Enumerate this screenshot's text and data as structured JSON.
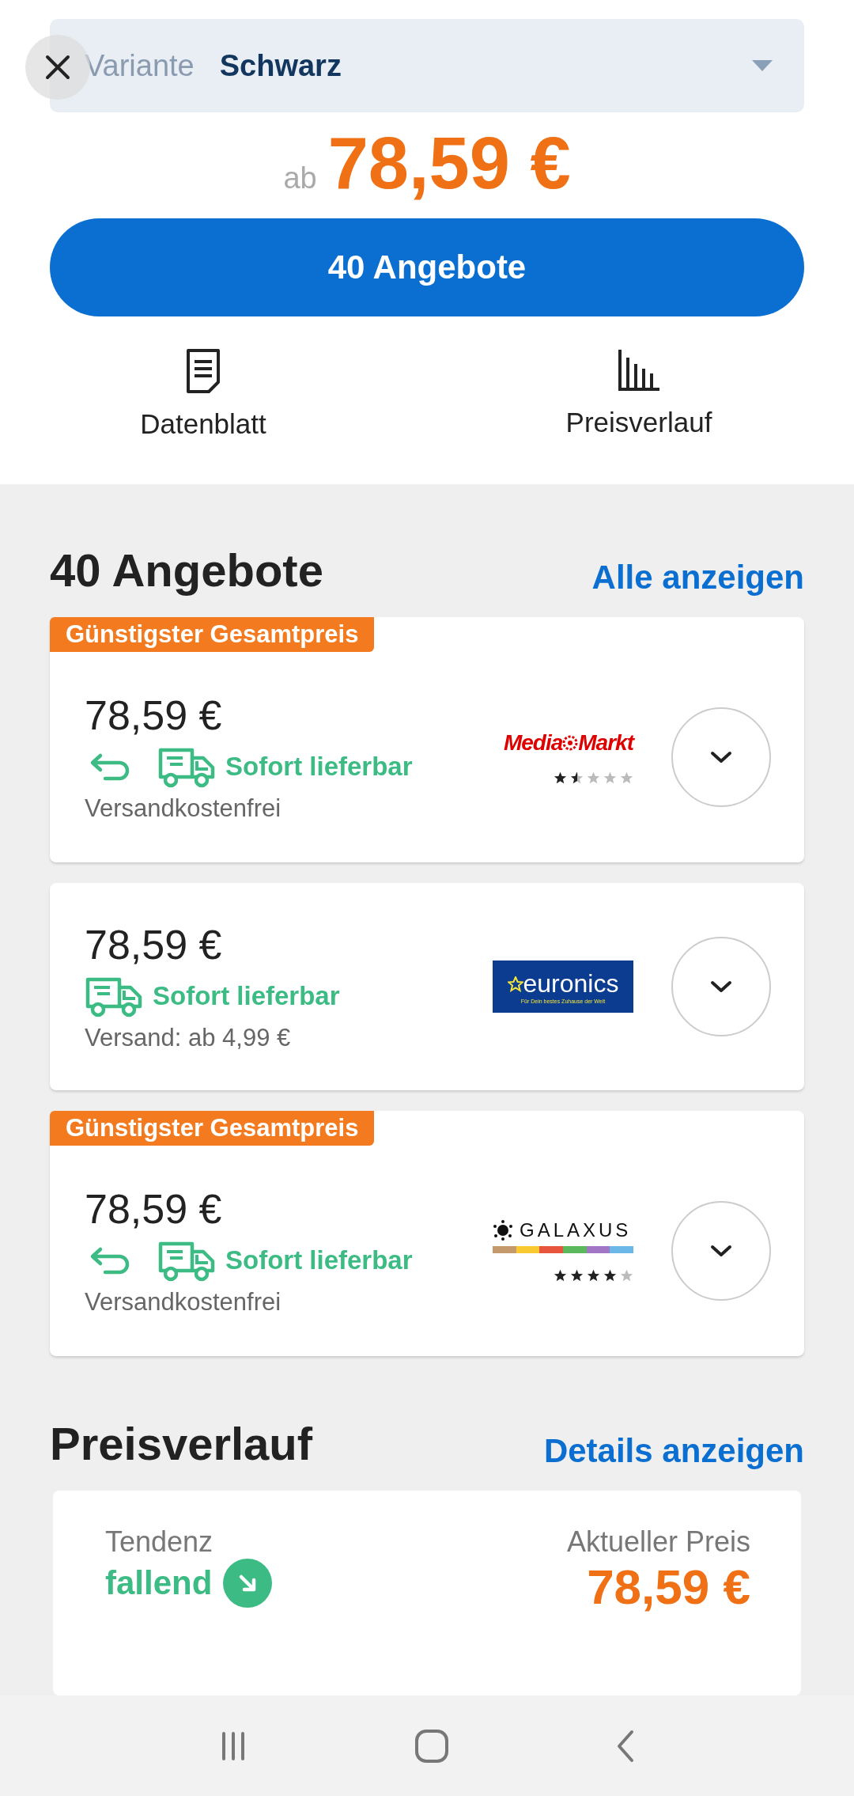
{
  "variant": {
    "label": "Variante",
    "value": "Schwarz"
  },
  "price": {
    "prefix": "ab",
    "value": "78,59 €"
  },
  "offers_button": "40 Angebote",
  "quick_links": [
    {
      "kind": "datasheet",
      "label": "Datenblatt"
    },
    {
      "kind": "history",
      "label": "Preisverlauf"
    }
  ],
  "offers_section": {
    "title": "40 Angebote",
    "link": "Alle anzeigen",
    "offers": [
      {
        "badge": "Günstigster Gesamtpreis",
        "price": "78,59 €",
        "returns": true,
        "availability": "Sofort lieferbar",
        "shipping": "Versandkostenfrei",
        "shop": {
          "kind": "mediamarkt",
          "words": [
            "Media",
            "Markt"
          ]
        },
        "stars": 1.5
      },
      {
        "price": "78,59 €",
        "returns": false,
        "availability": "Sofort lieferbar",
        "shipping": "Versand: ab 4,99 €",
        "shop": {
          "kind": "euronics",
          "words": [
            "euronics",
            "Für Dein bestes Zuhause der Welt"
          ]
        }
      },
      {
        "badge": "Günstigster Gesamtpreis",
        "price": "78,59 €",
        "returns": true,
        "availability": "Sofort lieferbar",
        "shipping": "Versandkostenfrei",
        "shop": {
          "kind": "galaxus",
          "words": [
            "GALAXUS"
          ]
        },
        "stars": 4
      }
    ]
  },
  "history_section": {
    "title": "Preisverlauf",
    "link": "Details anzeigen",
    "trend_label": "Tendenz",
    "trend": "fallend",
    "current_label": "Aktueller Preis",
    "current_price": "78,59 €"
  }
}
